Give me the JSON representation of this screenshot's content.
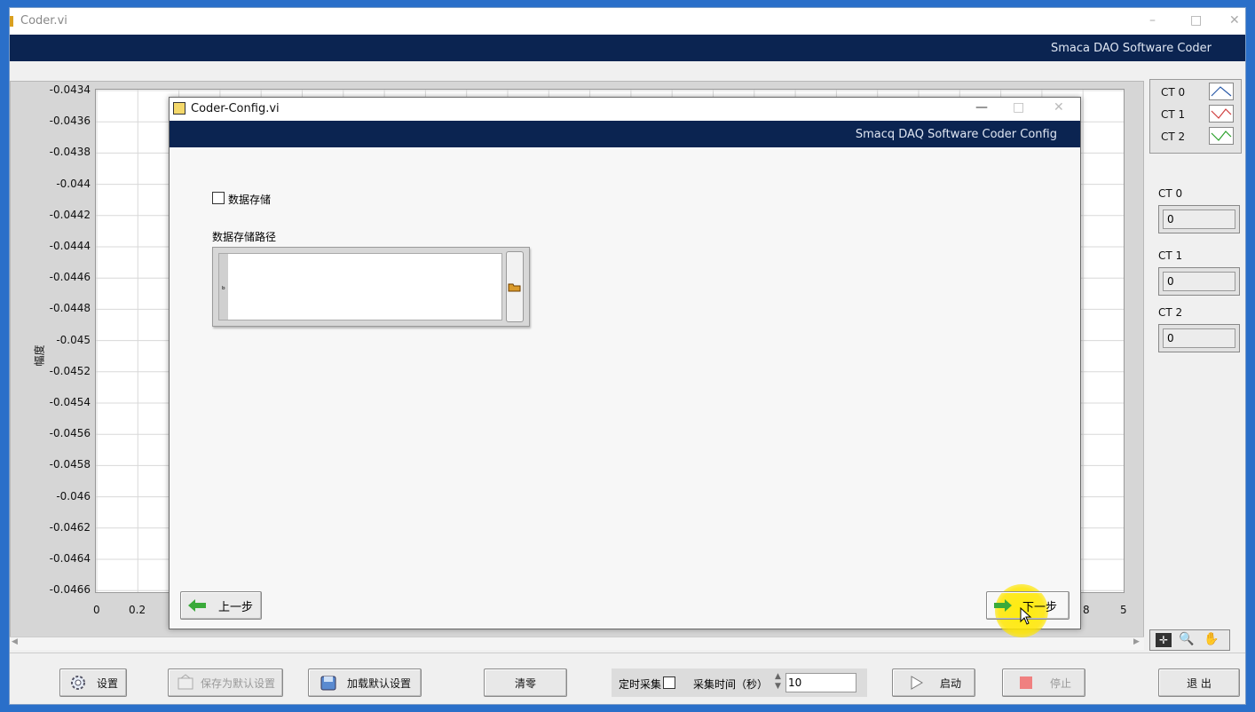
{
  "main_window": {
    "title": "Coder.vi",
    "banner": "Smaca DAO Software Coder",
    "min": "–",
    "max": "□",
    "close": "✕"
  },
  "graph": {
    "y_label": "幅度",
    "y_ticks": [
      "-0.0434",
      "-0.0436",
      "-0.0438",
      "-0.044",
      "-0.0442",
      "-0.0444",
      "-0.0446",
      "-0.0448",
      "-0.045",
      "-0.0452",
      "-0.0454",
      "-0.0456",
      "-0.0458",
      "-0.046",
      "-0.0462",
      "-0.0464",
      "-0.0466"
    ],
    "x_ticks_left": [
      "0",
      "0.2"
    ],
    "x_ticks_right": [
      "8",
      "5"
    ],
    "ylim": [
      -0.0466,
      -0.0434
    ]
  },
  "legend": [
    {
      "label": "CT 0",
      "color": "#2a5aa8"
    },
    {
      "label": "CT 1",
      "color": "#d04040"
    },
    {
      "label": "CT 2",
      "color": "#2aa02a"
    }
  ],
  "indicators": [
    {
      "label": "CT 0",
      "value": "0"
    },
    {
      "label": "CT 1",
      "value": "0"
    },
    {
      "label": "CT 2",
      "value": "0"
    }
  ],
  "bottom_bar": {
    "settings": "设置",
    "save_default": "保存为默认设置",
    "load_default": "加载默认设置",
    "clear": "清零",
    "timed_acq": "定时采集",
    "acq_time_label": "采集时间（秒）",
    "acq_time_value": "10",
    "start": "启动",
    "stop": "停止",
    "exit": "退 出"
  },
  "dialog": {
    "title": "Coder-Config.vi",
    "banner": "Smacq DAQ Software Coder Config",
    "min": "—",
    "max": "□",
    "close": "✕",
    "save_checkbox": "数据存储",
    "path_label": "数据存储路径",
    "path_value": "",
    "prev": "上一步",
    "next": "下一步"
  }
}
